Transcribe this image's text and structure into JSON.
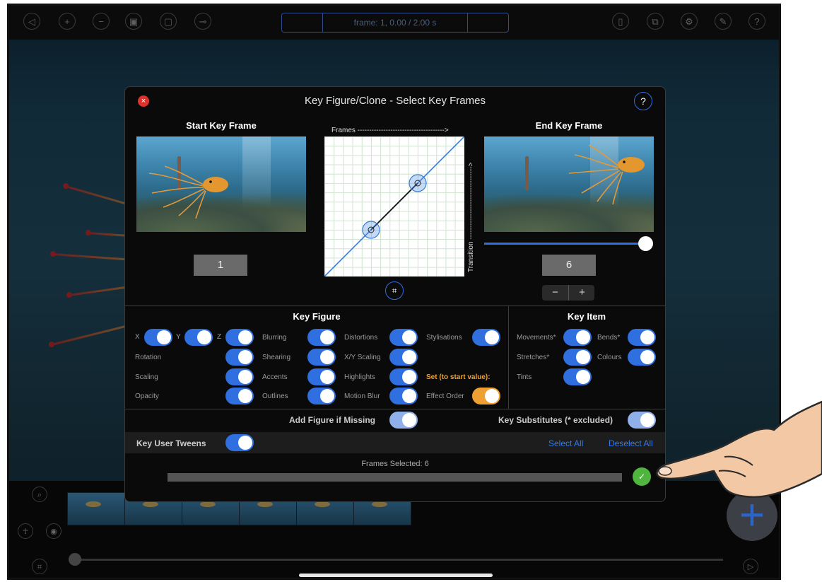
{
  "toolbar": {
    "frame_readout": "frame: 1, 0.00 / 2.00 s",
    "left_icons": [
      "back-icon",
      "add-icon",
      "remove-icon",
      "figure-icon",
      "layers-icon",
      "key-icon"
    ],
    "right_icons": [
      "clipboard-icon",
      "export-icon",
      "settings-icon",
      "tools-icon",
      "help-icon"
    ]
  },
  "dialog": {
    "title": "Key Figure/Clone - Select Key Frames",
    "help": "?",
    "start": {
      "label": "Start Key Frame",
      "value": "1"
    },
    "end": {
      "label": "End Key Frame",
      "value": "6",
      "slider_fraction": 1.0
    },
    "graph": {
      "x_label": "Frames ------------------------------------->",
      "y_label": "Transition ------------------------------->"
    },
    "stepper": {
      "minus": "−",
      "plus": "+"
    },
    "key_figure": {
      "title": "Key Figure",
      "x": "X",
      "y": "Y",
      "z": "Z",
      "rows_col1": [
        "Rotation",
        "Scaling",
        "Opacity"
      ],
      "col2": [
        "Blurring",
        "Shearing",
        "Accents",
        "Outlines"
      ],
      "col3": [
        "Distortions",
        "X/Y Scaling",
        "Highlights",
        "Motion Blur"
      ],
      "col4_label": "Stylisations",
      "set_start": "Set (to start value):",
      "effect_order": "Effect Order"
    },
    "key_item": {
      "title": "Key Item",
      "col1": [
        "Movements*",
        "Stretches*",
        "Tints"
      ],
      "col2": [
        "Bends*",
        "Colours"
      ]
    },
    "add_figure": "Add Figure if Missing",
    "key_substitutes": "Key Substitutes (* excluded)",
    "key_user_tweens": "Key User Tweens",
    "select_all": "Select All",
    "deselect_all": "Deselect All",
    "frames_selected": "Frames Selected: 6",
    "ok": "✓"
  },
  "colors": {
    "accent": "#2f6fe0",
    "orange": "#f0a030",
    "ok": "#4fb53e",
    "close": "#e0322c"
  }
}
